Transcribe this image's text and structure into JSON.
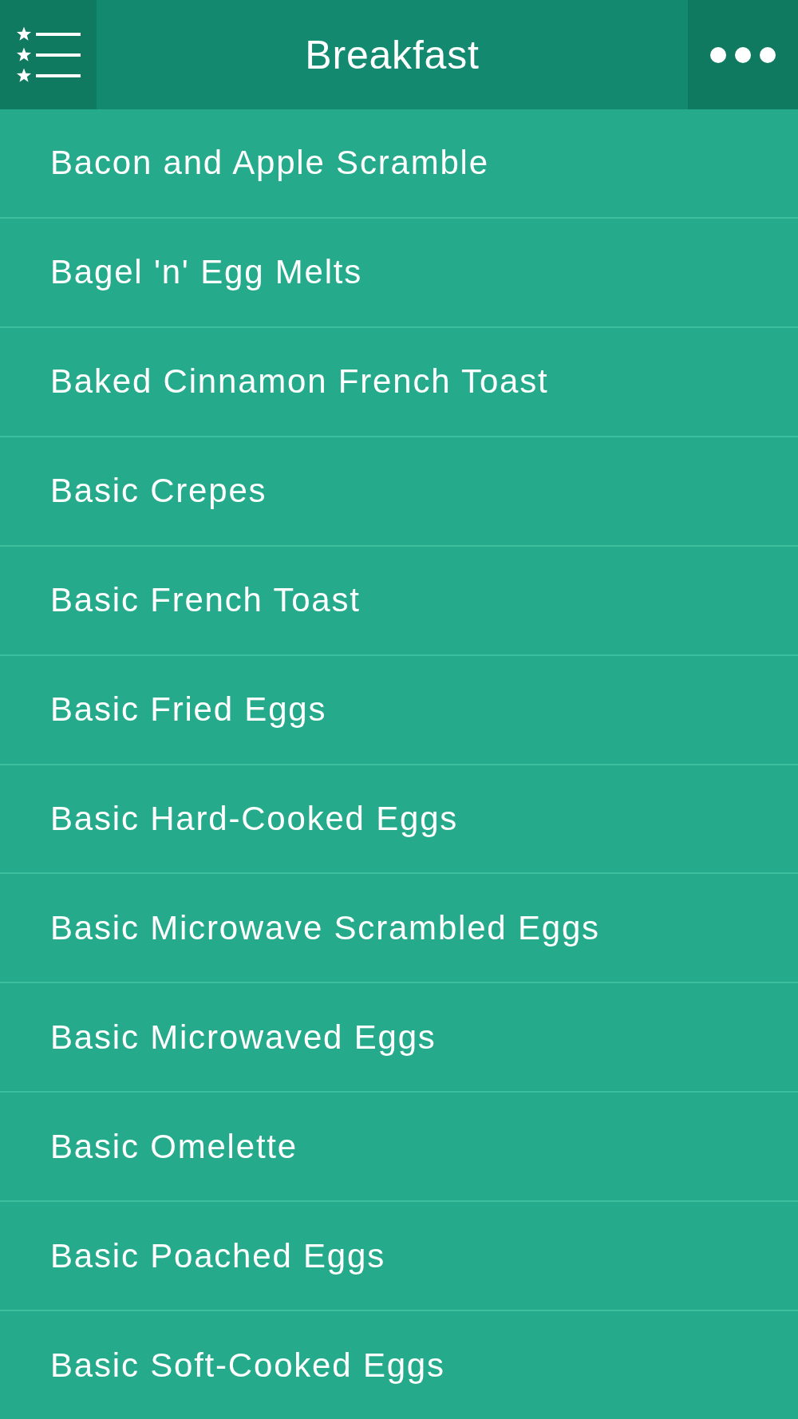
{
  "header": {
    "title": "Breakfast"
  },
  "recipes": [
    {
      "name": "Bacon and Apple Scramble"
    },
    {
      "name": "Bagel 'n' Egg Melts"
    },
    {
      "name": "Baked Cinnamon French Toast"
    },
    {
      "name": "Basic Crepes"
    },
    {
      "name": "Basic French Toast"
    },
    {
      "name": "Basic Fried Eggs"
    },
    {
      "name": "Basic Hard-Cooked Eggs"
    },
    {
      "name": "Basic Microwave Scrambled Eggs"
    },
    {
      "name": "Basic Microwaved Eggs"
    },
    {
      "name": "Basic Omelette"
    },
    {
      "name": "Basic Poached Eggs"
    },
    {
      "name": "Basic Soft-Cooked Eggs"
    }
  ]
}
